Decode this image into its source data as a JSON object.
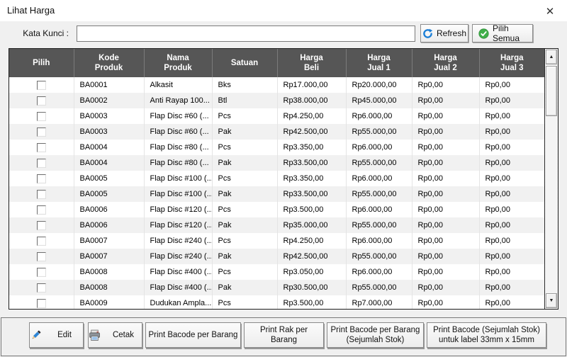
{
  "window": {
    "title": "Lihat Harga"
  },
  "icons": {
    "close": "✕",
    "scroll_up": "▲",
    "scroll_down": "▼",
    "refresh": "refresh-circular-arrow",
    "select_all": "green-check-circle",
    "edit": "pencil",
    "cetak": "printer"
  },
  "colors": {
    "accent_blue": "#1b7ed6",
    "accent_green": "#3fae49",
    "header_bg": "#565656",
    "row_stripe": "#f1f1f1"
  },
  "toolbar": {
    "keyword_label": "Kata Kunci :",
    "keyword_value": "",
    "keyword_placeholder": "",
    "refresh_label": "Refresh",
    "select_all_label": "Pilih Semua"
  },
  "table": {
    "headers": [
      "Pilih",
      "Kode\nProduk",
      "Nama\nProduk",
      "Satuan",
      "Harga\nBeli",
      "Harga\nJual 1",
      "Harga\nJual 2",
      "Harga\nJual 3"
    ],
    "rows": [
      [
        "BA0001",
        "Alkasit",
        "Bks",
        "Rp17.000,00",
        "Rp20.000,00",
        "Rp0,00",
        "Rp0,00"
      ],
      [
        "BA0002",
        "Anti Rayap 100...",
        "Btl",
        "Rp38.000,00",
        "Rp45.000,00",
        "Rp0,00",
        "Rp0,00"
      ],
      [
        "BA0003",
        "Flap Disc #60 (...",
        "Pcs",
        "Rp4.250,00",
        "Rp6.000,00",
        "Rp0,00",
        "Rp0,00"
      ],
      [
        "BA0003",
        "Flap Disc #60 (...",
        "Pak",
        "Rp42.500,00",
        "Rp55.000,00",
        "Rp0,00",
        "Rp0,00"
      ],
      [
        "BA0004",
        "Flap Disc #80 (...",
        "Pcs",
        "Rp3.350,00",
        "Rp6.000,00",
        "Rp0,00",
        "Rp0,00"
      ],
      [
        "BA0004",
        "Flap Disc #80 (...",
        "Pak",
        "Rp33.500,00",
        "Rp55.000,00",
        "Rp0,00",
        "Rp0,00"
      ],
      [
        "BA0005",
        "Flap Disc #100 (...",
        "Pcs",
        "Rp3.350,00",
        "Rp6.000,00",
        "Rp0,00",
        "Rp0,00"
      ],
      [
        "BA0005",
        "Flap Disc #100 (...",
        "Pak",
        "Rp33.500,00",
        "Rp55.000,00",
        "Rp0,00",
        "Rp0,00"
      ],
      [
        "BA0006",
        "Flap Disc #120 (...",
        "Pcs",
        "Rp3.500,00",
        "Rp6.000,00",
        "Rp0,00",
        "Rp0,00"
      ],
      [
        "BA0006",
        "Flap Disc #120 (...",
        "Pak",
        "Rp35.000,00",
        "Rp55.000,00",
        "Rp0,00",
        "Rp0,00"
      ],
      [
        "BA0007",
        "Flap Disc #240 (...",
        "Pcs",
        "Rp4.250,00",
        "Rp6.000,00",
        "Rp0,00",
        "Rp0,00"
      ],
      [
        "BA0007",
        "Flap Disc #240 (...",
        "Pak",
        "Rp42.500,00",
        "Rp55.000,00",
        "Rp0,00",
        "Rp0,00"
      ],
      [
        "BA0008",
        "Flap Disc #400 (...",
        "Pcs",
        "Rp3.050,00",
        "Rp6.000,00",
        "Rp0,00",
        "Rp0,00"
      ],
      [
        "BA0008",
        "Flap Disc #400 (...",
        "Pak",
        "Rp30.500,00",
        "Rp55.000,00",
        "Rp0,00",
        "Rp0,00"
      ],
      [
        "BA0009",
        "Dudukan Ampla...",
        "Pcs",
        "Rp3.500,00",
        "Rp7.000,00",
        "Rp0,00",
        "Rp0,00"
      ]
    ]
  },
  "footer": {
    "edit_label": "Edit",
    "cetak_label": "Cetak",
    "print_barcode_label": "Print Bacode per Barang",
    "print_rak_label": "Print Rak per\nBarang",
    "print_barcode_stok_label": "Print Bacode per Barang\n(Sejumlah Stok)",
    "print_barcode_33_label": "Print Bacode (Sejumlah Stok)\nuntuk label 33mm x 15mm"
  }
}
